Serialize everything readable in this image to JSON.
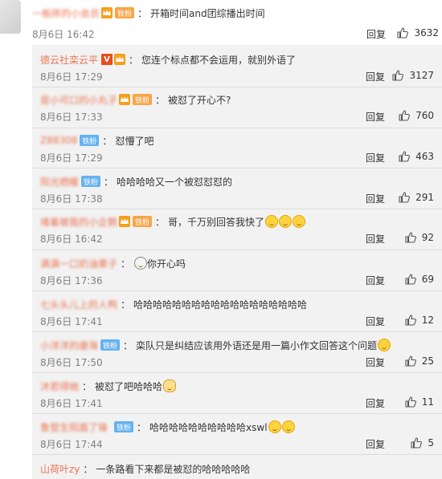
{
  "first_comment": {
    "username": "一板砖的小会员",
    "badge": "铁粉",
    "text": "开箱时间and团综播出时间",
    "date": "8月6日 16:42",
    "reply_label": "回复",
    "likes": "3632"
  },
  "replies": [
    {
      "username": "德云社栾云平",
      "badge": "",
      "text": "您连个标点都不会运用，就别外语了",
      "date": "8月6日 17:29",
      "reply_label": "回复",
      "likes": "3127",
      "verified": true,
      "blurred": false
    },
    {
      "username": "是小可口的小丸子",
      "badge": "铁粉",
      "text": "被怼了开心不?",
      "date": "8月6日 17:33",
      "reply_label": "回复",
      "likes": "760",
      "blurred": true
    },
    {
      "username": "Z88308",
      "badge": "铁粉",
      "text": "怼懵了吧",
      "date": "8月6日 17:29",
      "reply_label": "回复",
      "likes": "463",
      "blurred": true
    },
    {
      "username": "阳光晒暖",
      "badge": "铁粉",
      "text": "哈哈哈哈又一个被怼怼怼的",
      "date": "8月6日 17:38",
      "reply_label": "回复",
      "likes": "291",
      "blurred": true
    },
    {
      "username": "堵着被我的小企鹅",
      "badge": "铁粉",
      "text": "哥，千万别回答我快了",
      "date": "8月6日 16:42",
      "reply_label": "回复",
      "likes": "92",
      "blurred": true
    },
    {
      "username": "满满一口奶油栗子",
      "badge": "",
      "text": "你开心吗",
      "date": "8月6日 17:36",
      "reply_label": "回复",
      "likes": "69",
      "blurred": true
    },
    {
      "username": "七头头儿上的人鸭",
      "badge": "",
      "text": "哈哈哈哈哈哈哈哈哈哈哈哈哈哈哈哈哈哈",
      "date": "8月6日 17:41",
      "reply_label": "回复",
      "likes": "12",
      "blurred": true
    },
    {
      "username": "小洋洋的康海",
      "badge": "铁粉",
      "text": "栾队只是纠结应该用外语还是用一篇小作文回答这个问题",
      "date": "8月6日 17:50",
      "reply_label": "回复",
      "likes": "25",
      "blurred": true
    },
    {
      "username": "沐若得她",
      "badge": "",
      "text": "被怼了吧哈哈哈",
      "date": "8月6日 17:41",
      "reply_label": "回复",
      "likes": "11",
      "blurred": true
    },
    {
      "username": "鲁登生阳面了锋",
      "badge": "铁粉",
      "text": "哈哈哈哈哈哈哈哈哈哈xswl",
      "date": "8月6日 17:44",
      "reply_label": "回复",
      "likes": "5",
      "blurred": true
    },
    {
      "username": "山荷叶zy",
      "badge": "",
      "text": "一条路看下来都是被怼的哈哈哈哈哈",
      "date": "",
      "reply_label": "",
      "likes": "",
      "blurred": false
    }
  ],
  "icons": {
    "like": "thumbs-up-icon",
    "vip": "vip-crown-icon",
    "verified": "verified-v-icon",
    "emoji": "laughing-emoji-icon"
  },
  "colors": {
    "username": "#eb7350",
    "panel_bg": "#f2f2f2",
    "badge": "#f8a548"
  }
}
